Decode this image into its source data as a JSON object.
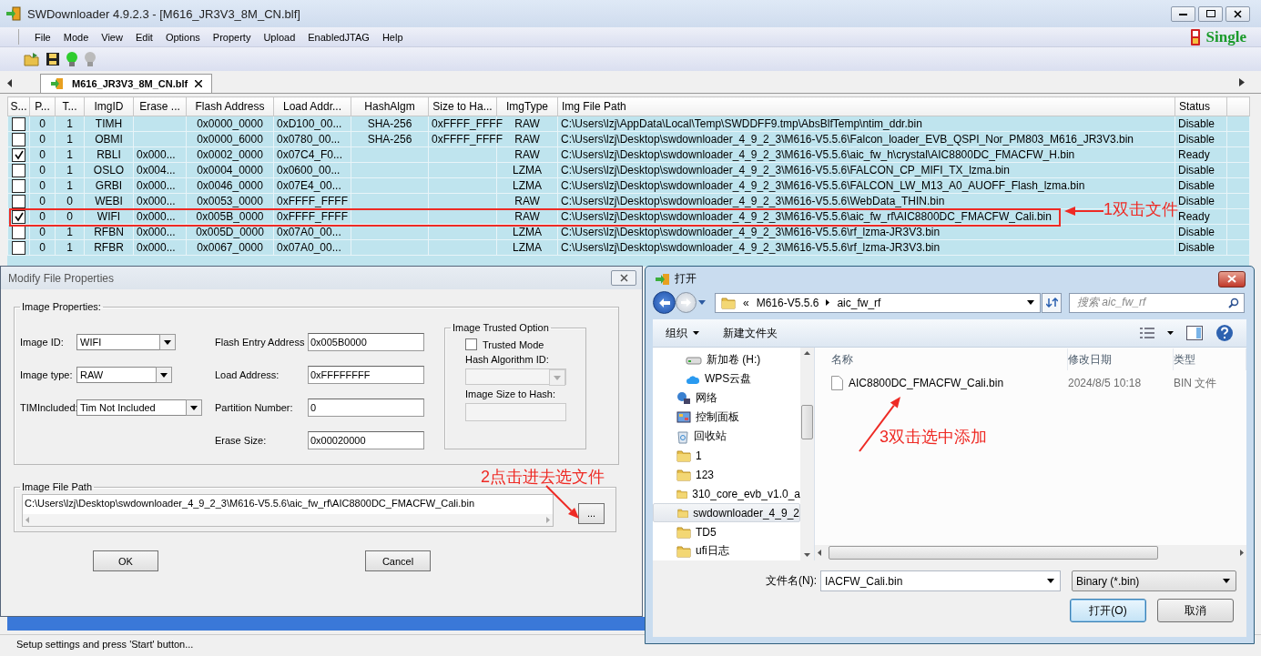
{
  "window": {
    "title": "SWDownloader 4.9.2.3 - [M616_JR3V3_8M_CN.blf]"
  },
  "menu": [
    "File",
    "Mode",
    "View",
    "Edit",
    "Options",
    "Property",
    "Upload",
    "EnabledJTAG",
    "Help"
  ],
  "mode_indicator": {
    "text": "Single"
  },
  "tabs": [
    {
      "label": "M616_JR3V3_8M_CN.blf",
      "selected": true
    }
  ],
  "table": {
    "columns": [
      "S...",
      "P...",
      "T...",
      "ImgID",
      "Erase ...",
      "Flash Address",
      "Load Addr...",
      "HashAlgm",
      "Size to Ha...",
      "ImgType",
      "Img File Path",
      "Status"
    ],
    "rows": [
      {
        "checked": false,
        "cells": [
          null,
          "0",
          "1",
          "TIMH",
          null,
          "0x0000_0000",
          "0xD100_00...",
          "SHA-256",
          "0xFFFF_FFFF",
          "RAW",
          "C:\\Users\\lzj\\AppData\\Local\\Temp\\SWDDFF9.tmp\\AbsBlfTemp\\ntim_ddr.bin",
          "Disable"
        ]
      },
      {
        "checked": false,
        "cells": [
          null,
          "0",
          "1",
          "OBMI",
          null,
          "0x0000_6000",
          "0x0780_00...",
          "SHA-256",
          "0xFFFF_FFFF",
          "RAW",
          "C:\\Users\\lzj\\Desktop\\swdownloader_4_9_2_3\\M616-V5.5.6\\Falcon_loader_EVB_QSPI_Nor_PM803_M616_JR3V3.bin",
          "Disable"
        ]
      },
      {
        "checked": true,
        "cells": [
          null,
          "0",
          "1",
          "RBLI",
          "0x000...",
          "0x0002_0000",
          "0x07C4_F0...",
          null,
          null,
          "RAW",
          "C:\\Users\\lzj\\Desktop\\swdownloader_4_9_2_3\\M616-V5.5.6\\aic_fw_h\\crystal\\AIC8800DC_FMACFW_H.bin",
          "Ready"
        ]
      },
      {
        "checked": false,
        "cells": [
          null,
          "0",
          "1",
          "OSLO",
          "0x004...",
          "0x0004_0000",
          "0x0600_00...",
          null,
          null,
          "LZMA",
          "C:\\Users\\lzj\\Desktop\\swdownloader_4_9_2_3\\M616-V5.5.6\\FALCON_CP_MIFI_TX_lzma.bin",
          "Disable"
        ]
      },
      {
        "checked": false,
        "cells": [
          null,
          "0",
          "1",
          "GRBI",
          "0x000...",
          "0x0046_0000",
          "0x07E4_00...",
          null,
          null,
          "LZMA",
          "C:\\Users\\lzj\\Desktop\\swdownloader_4_9_2_3\\M616-V5.5.6\\FALCON_LW_M13_A0_AUOFF_Flash_lzma.bin",
          "Disable"
        ]
      },
      {
        "checked": false,
        "cells": [
          null,
          "0",
          "0",
          "WEBI",
          "0x000...",
          "0x0053_0000",
          "0xFFFF_FFFF",
          null,
          null,
          "RAW",
          "C:\\Users\\lzj\\Desktop\\swdownloader_4_9_2_3\\M616-V5.5.6\\WebData_THIN.bin",
          "Disable"
        ]
      },
      {
        "checked": true,
        "cells": [
          null,
          "0",
          "0",
          "WIFI",
          "0x000...",
          "0x005B_0000",
          "0xFFFF_FFFF",
          null,
          null,
          "RAW",
          "C:\\Users\\lzj\\Desktop\\swdownloader_4_9_2_3\\M616-V5.5.6\\aic_fw_rf\\AIC8800DC_FMACFW_Cali.bin",
          "Ready"
        ]
      },
      {
        "checked": false,
        "cells": [
          null,
          "0",
          "1",
          "RFBN",
          "0x000...",
          "0x005D_0000",
          "0x07A0_00...",
          null,
          null,
          "LZMA",
          "C:\\Users\\lzj\\Desktop\\swdownloader_4_9_2_3\\M616-V5.5.6\\rf_lzma-JR3V3.bin",
          "Disable"
        ]
      },
      {
        "checked": false,
        "cells": [
          null,
          "0",
          "1",
          "RFBR",
          "0x000...",
          "0x0067_0000",
          "0x07A0_00...",
          null,
          null,
          "LZMA",
          "C:\\Users\\lzj\\Desktop\\swdownloader_4_9_2_3\\M616-V5.5.6\\rf_lzma-JR3V3.bin",
          "Disable"
        ]
      }
    ]
  },
  "status_bar": "Setup settings and press 'Start' button...",
  "modify_dialog": {
    "title": "Modify File Properties",
    "properties_group": "Image Properties:",
    "left_fields": [
      {
        "label": "Image ID:",
        "value": "WIFI"
      },
      {
        "label": "Image type:",
        "value": "RAW"
      },
      {
        "label": "TIMIncluded:",
        "value": "Tim Not Included"
      }
    ],
    "right_fields": [
      {
        "label": "Flash Entry Address :",
        "value": "0x005B0000"
      },
      {
        "label": "Load Address:",
        "value": "0xFFFFFFFF"
      },
      {
        "label": "Partition Number:",
        "value": "0"
      },
      {
        "label": "Erase Size:",
        "value": "0x00020000"
      }
    ],
    "trusted_group": {
      "title": "Image Trusted Option",
      "checkbox": {
        "label": "Trusted Mode",
        "checked": false
      },
      "hash_label": "Hash Algorithm ID:",
      "hash_disabled": true,
      "size_label": "Image Size to Hash:",
      "size_disabled": true
    },
    "path_group": "Image File Path",
    "path_value": "C:\\Users\\lzj\\Desktop\\swdownloader_4_9_2_3\\M616-V5.5.6\\aic_fw_rf\\AIC8800DC_FMACFW_Cali.bin",
    "browse_button": "...",
    "buttons": [
      "OK",
      "Cancel"
    ]
  },
  "open_dialog": {
    "title": "打开",
    "breadcrumb": [
      "«",
      "M616-V5.5.6",
      "aic_fw_rf"
    ],
    "search": {
      "placeholder": "搜索 aic_fw_rf"
    },
    "commands": [
      "组织",
      "新建文件夹"
    ],
    "nav": [
      {
        "label": "新加卷 (H:)",
        "kind": "drive",
        "selected": false
      },
      {
        "label": "WPS云盘",
        "kind": "cloud",
        "selected": false
      },
      {
        "label": "网络",
        "kind": "network",
        "selected": false
      },
      {
        "label": "控制面板",
        "kind": "panel",
        "selected": false
      },
      {
        "label": "回收站",
        "kind": "bin",
        "selected": false
      },
      {
        "label": "1",
        "kind": "folder",
        "selected": false
      },
      {
        "label": "123",
        "kind": "folder",
        "selected": false
      },
      {
        "label": "310_core_evb_v1.0_a",
        "kind": "folder",
        "selected": false
      },
      {
        "label": "swdownloader_4_9_2",
        "kind": "folder",
        "selected": true
      },
      {
        "label": "TD5",
        "kind": "folder",
        "selected": false
      },
      {
        "label": "ufi日志",
        "kind": "folder",
        "selected": false
      }
    ],
    "columns": [
      "名称",
      "修改日期",
      "类型"
    ],
    "files": [
      {
        "name": "AIC8800DC_FMACFW_Cali.bin",
        "date": "2024/8/5 10:18",
        "type": "BIN 文件"
      }
    ],
    "filename_label": "文件名(N):",
    "filename_value": "IACFW_Cali.bin",
    "filter": "Binary (*.bin)",
    "buttons": [
      "打开(O)",
      "取消"
    ]
  },
  "annotations": [
    {
      "text": "1双击文件"
    },
    {
      "text": "2点击进去选文件"
    },
    {
      "text": "3双击选中添加"
    }
  ]
}
